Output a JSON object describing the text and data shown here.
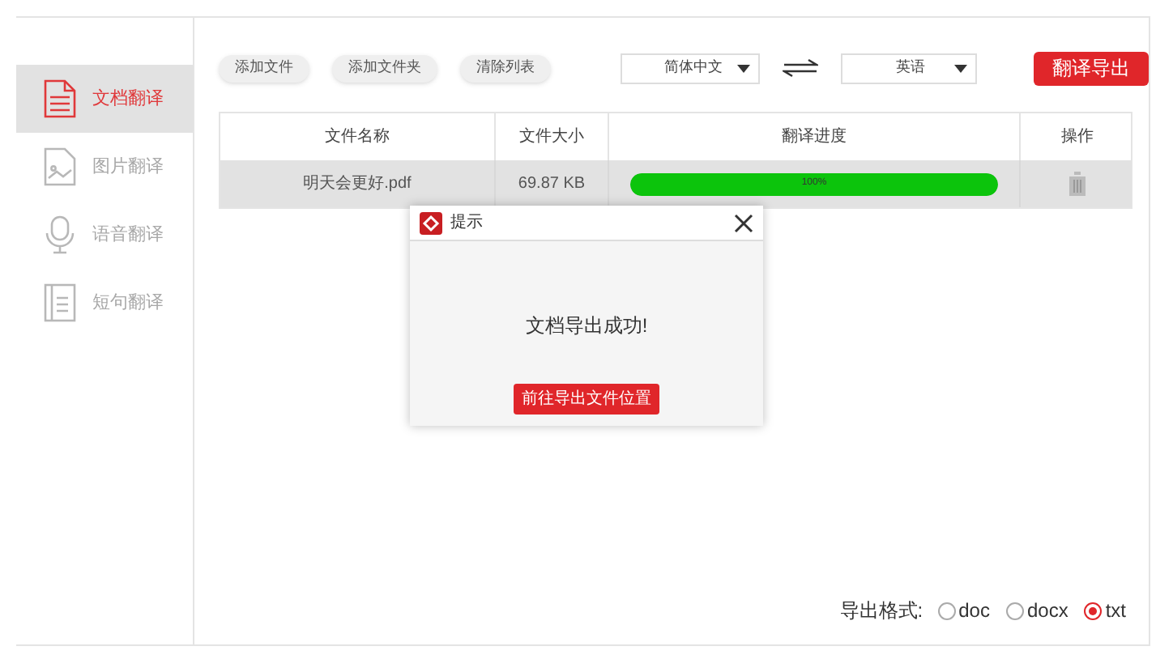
{
  "sidebar": {
    "items": [
      {
        "kind": "document",
        "label": "文档翻译",
        "selected": true
      },
      {
        "kind": "image",
        "label": "图片翻译",
        "selected": false
      },
      {
        "kind": "voice",
        "label": "语音翻译",
        "selected": false
      },
      {
        "kind": "sentence",
        "label": "短句翻译",
        "selected": false
      }
    ]
  },
  "toolbar": {
    "buttons": [
      "添加文件",
      "添加文件夹",
      "清除列表"
    ],
    "source_language": "简体中文",
    "target_language": "英语",
    "export_button": "翻译导出"
  },
  "table": {
    "columns": [
      "文件名称",
      "文件大小",
      "翻译进度",
      "操作"
    ],
    "rows": [
      {
        "name": "明天会更好.pdf",
        "size": "69.87 KB",
        "progress": "100%",
        "level": 1,
        "selected": true
      }
    ]
  },
  "dialog": {
    "title": "提示",
    "message": "文档导出成功!",
    "button": "前往导出文件位置"
  },
  "export_format": {
    "label": "导出格式:",
    "options": [
      {
        "label": "doc",
        "selected": false
      },
      {
        "label": "docx",
        "selected": false
      },
      {
        "label": "txt",
        "selected": true
      }
    ]
  }
}
